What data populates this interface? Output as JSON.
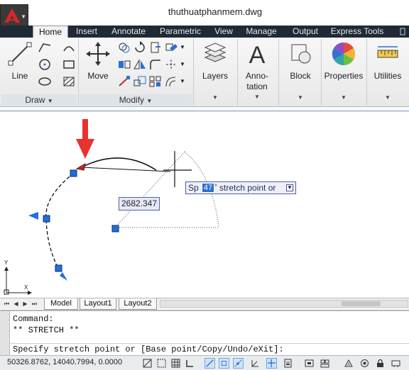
{
  "app": {
    "title": "thuthuatphanmem.dwg"
  },
  "tabs": [
    {
      "label": "Home",
      "active": true
    },
    {
      "label": "Insert"
    },
    {
      "label": "Annotate"
    },
    {
      "label": "Parametric"
    },
    {
      "label": "View"
    },
    {
      "label": "Manage"
    },
    {
      "label": "Output"
    },
    {
      "label": "Express Tools"
    }
  ],
  "ribbon": {
    "draw": {
      "title": "Draw",
      "line_label": "Line"
    },
    "modify": {
      "title": "Modify",
      "move_label": "Move"
    },
    "layers_label": "Layers",
    "annotation_label_1": "Anno-",
    "annotation_label_2": "tation",
    "block_label": "Block",
    "properties_label": "Properties",
    "utilities_label": "Utilities"
  },
  "drawing": {
    "dynamic_input": {
      "prefix": "Sp",
      "angle": "47",
      "angle_unit": "°",
      "prompt": "stretch point or"
    },
    "dimension_value": "2682.347",
    "ucs": {
      "x": "X",
      "y": "Y"
    }
  },
  "layout_tabs": [
    {
      "label": "Model",
      "active": true
    },
    {
      "label": "Layout1"
    },
    {
      "label": "Layout2"
    }
  ],
  "command": {
    "line1": "Command:",
    "line2": "** STRETCH **",
    "prompt": "Specify stretch point or [Base point/Copy/Undo/eXit]:"
  },
  "status": {
    "coordinates": "50326.8762, 14040.7994, 0.0000"
  },
  "colors": {
    "accent": "#2f6fd0",
    "grip": "#1f6fe0",
    "hot_grip": "#c0282d",
    "arrow": "#e8322d",
    "tabbar": "#1f2a36"
  }
}
